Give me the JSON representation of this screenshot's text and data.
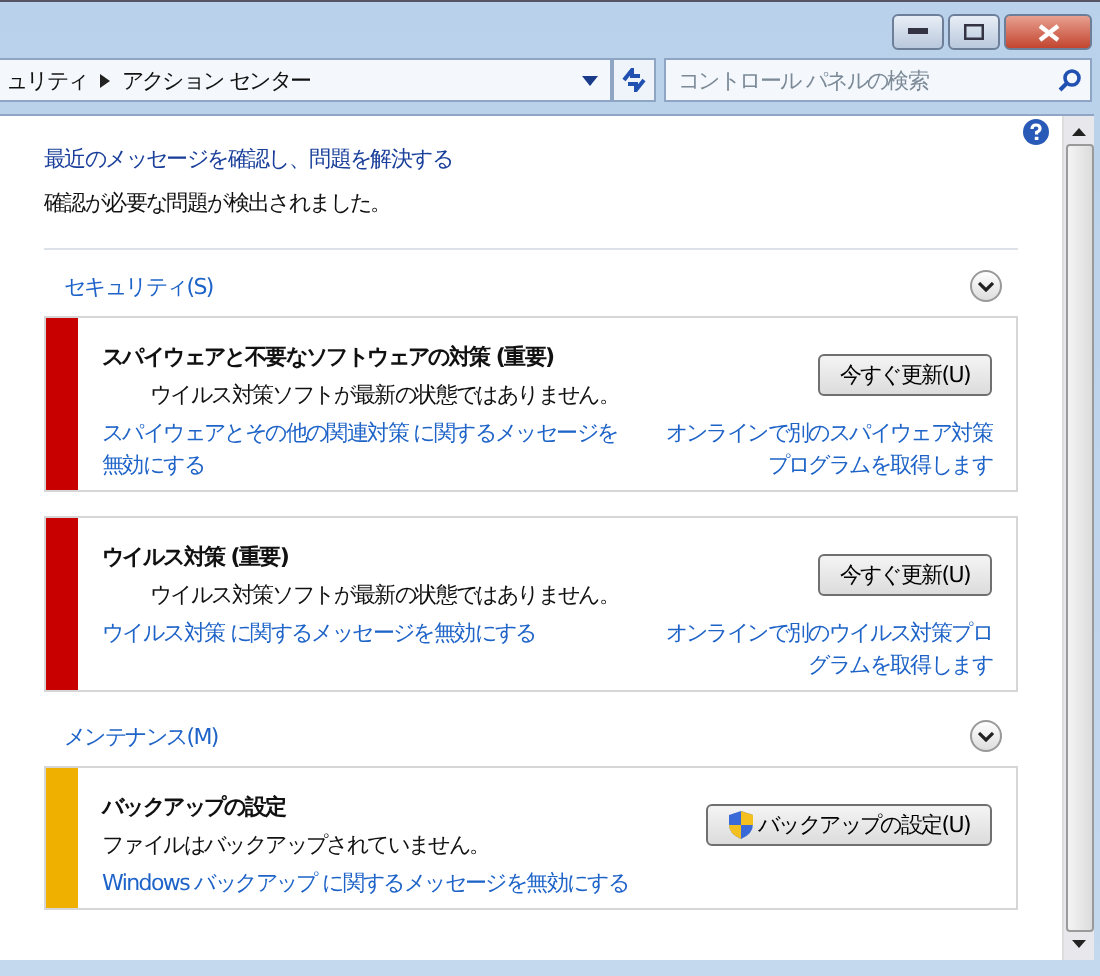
{
  "address_bar": {
    "crumbs": [
      "ュリティ",
      "アクション センター"
    ]
  },
  "search": {
    "placeholder": "コントロール パネルの検索"
  },
  "header": {
    "link": "最近のメッセージを確認し、問題を解決する",
    "status": "確認が必要な問題が検出されました。"
  },
  "sections": [
    {
      "title": "セキュリティ(S)",
      "cards": [
        {
          "color": "#c80000",
          "title": "スパイウェアと不要なソフトウェアの対策 (重要)",
          "message": "ウイルス対策ソフトが最新の状態ではありません。",
          "indent": true,
          "button": {
            "label": "今すぐ更新(U)",
            "shield": false
          },
          "disable_link": "スパイウェアとその他の関連対策 に関するメッセージを無効にする",
          "alt_link": "オンラインで別のスパイウェア対策プログラムを取得します"
        },
        {
          "color": "#c80000",
          "title": "ウイルス対策 (重要)",
          "message": "ウイルス対策ソフトが最新の状態ではありません。",
          "indent": true,
          "button": {
            "label": "今すぐ更新(U)",
            "shield": false
          },
          "disable_link": "ウイルス対策 に関するメッセージを無効にする",
          "alt_link": "オンラインで別のウイルス対策プログラムを取得します"
        }
      ]
    },
    {
      "title": "メンテナンス(M)",
      "cards": [
        {
          "color": "#f0b000",
          "title": "バックアップの設定",
          "message": "ファイルはバックアップされていません。",
          "indent": false,
          "button": {
            "label": "バックアップの設定(U)",
            "shield": true
          },
          "disable_link": "Windows バックアップ に関するメッセージを無効にする"
        }
      ]
    }
  ]
}
